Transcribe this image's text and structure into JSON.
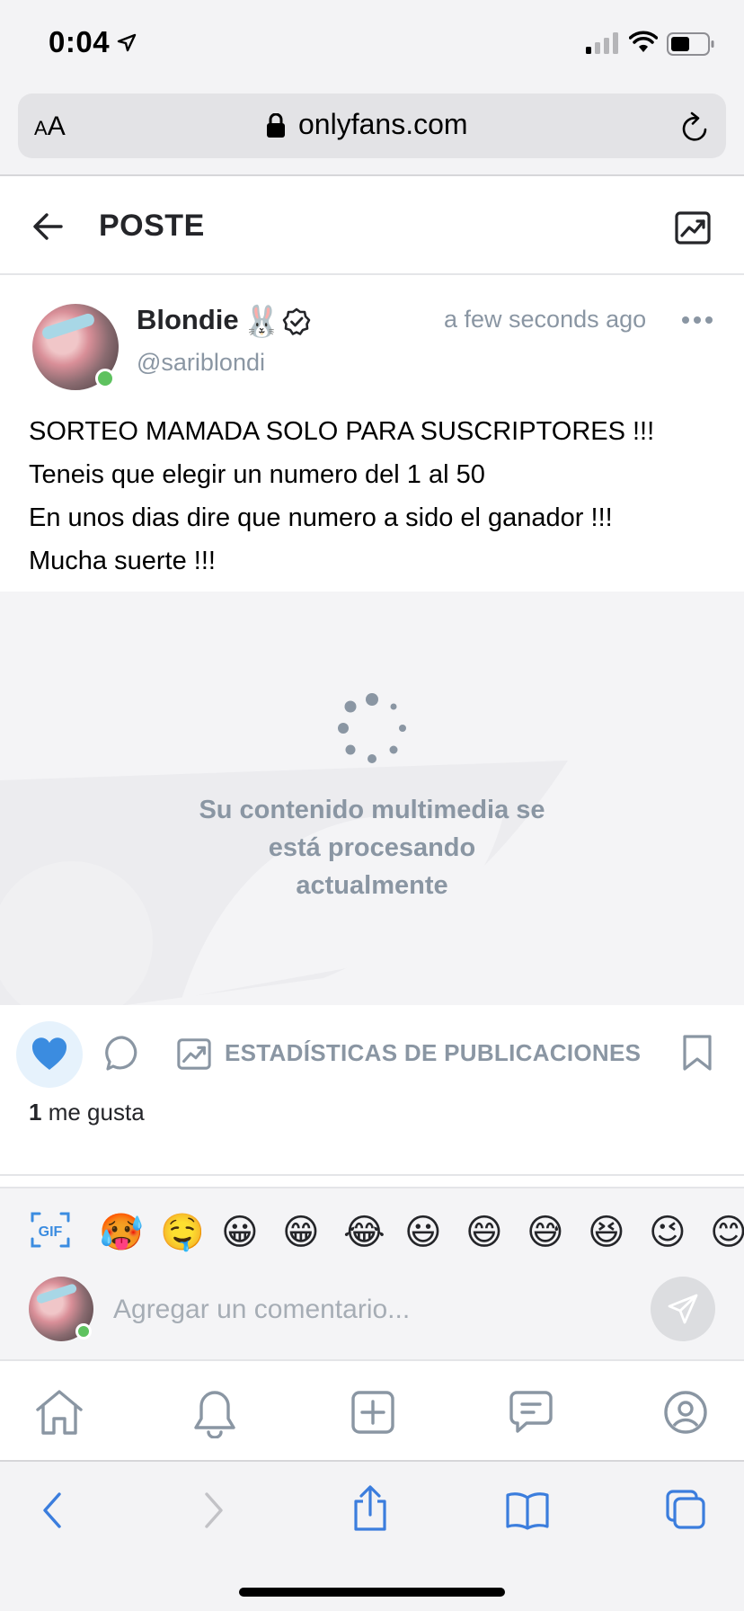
{
  "status_bar": {
    "time": "0:04"
  },
  "browser": {
    "text_size_label_small": "A",
    "text_size_label_large": "A",
    "url": "onlyfans.com"
  },
  "header": {
    "title": "POSTE"
  },
  "post": {
    "author_name": "Blondie",
    "author_emoji": "🐰",
    "handle": "@sariblondi",
    "timestamp": "a few seconds ago",
    "text_lines": [
      "SORTEO MAMADA SOLO PARA SUSCRIPTORES !!!",
      "Teneis que elegir un numero del 1 al 50",
      "En unos dias dire que numero a sido el ganador !!!",
      "Mucha suerte !!!"
    ],
    "media_status_lines": [
      "Su contenido multimedia se",
      "está procesando",
      "actualmente"
    ]
  },
  "actions": {
    "stats_label": "ESTADÍSTICAS DE PUBLICACIONES",
    "likes_count": "1",
    "likes_label": "me gusta"
  },
  "composer": {
    "gif_label": "GIF",
    "emojis": [
      "🥵",
      "🤤",
      "😀",
      "😁",
      "😂",
      "😃",
      "😄",
      "😅",
      "😆",
      "😉",
      "😊"
    ],
    "placeholder": "Agregar un comentario..."
  },
  "colors": {
    "accent": "#00aff0",
    "muted": "#8a96a3",
    "online": "#5ec25f",
    "ios_blue": "#3b7ddd"
  }
}
